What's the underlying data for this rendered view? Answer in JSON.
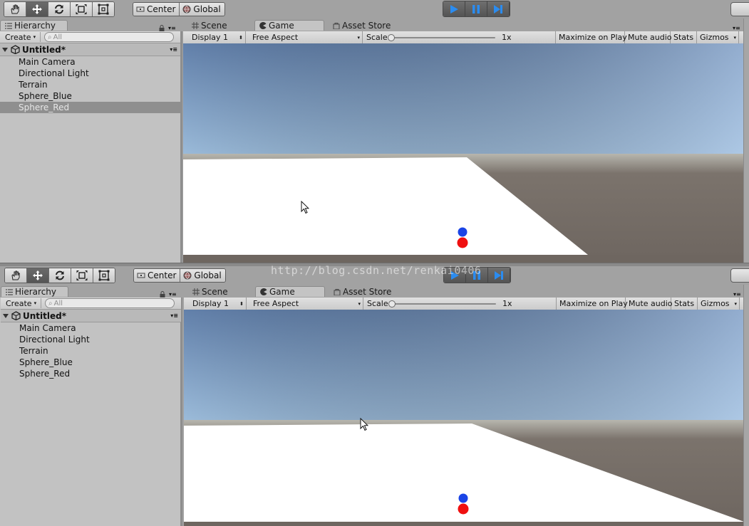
{
  "toolbar": {
    "pivot_label": "Center",
    "space_label": "Global"
  },
  "hierarchy": {
    "tab_label": "Hierarchy",
    "create_label": "Create",
    "search_placeholder": "All",
    "scene_name": "Untitled*",
    "items": [
      {
        "label": "Main Camera"
      },
      {
        "label": "Directional Light"
      },
      {
        "label": "Terrain"
      },
      {
        "label": "Sphere_Blue"
      },
      {
        "label": "Sphere_Red"
      }
    ],
    "selected_top": "Sphere_Red"
  },
  "tabs": {
    "scene": "Scene",
    "game": "Game",
    "asset_store": "Asset Store"
  },
  "game_toolbar": {
    "display": "Display 1",
    "aspect": "Free Aspect",
    "scale_label": "Scale",
    "scale_value": "1x",
    "maximize": "Maximize on Play",
    "mute": "Mute audio",
    "stats": "Stats",
    "gizmos": "Gizmos"
  },
  "colors": {
    "play_accent": "#2b8cf0",
    "sphere_blue": "#1a44e6",
    "sphere_red": "#ef1010",
    "ground": "#ffffff",
    "terrain_shadow": "#6e6660"
  },
  "watermark": "http://blog.csdn.net/renkai0406"
}
